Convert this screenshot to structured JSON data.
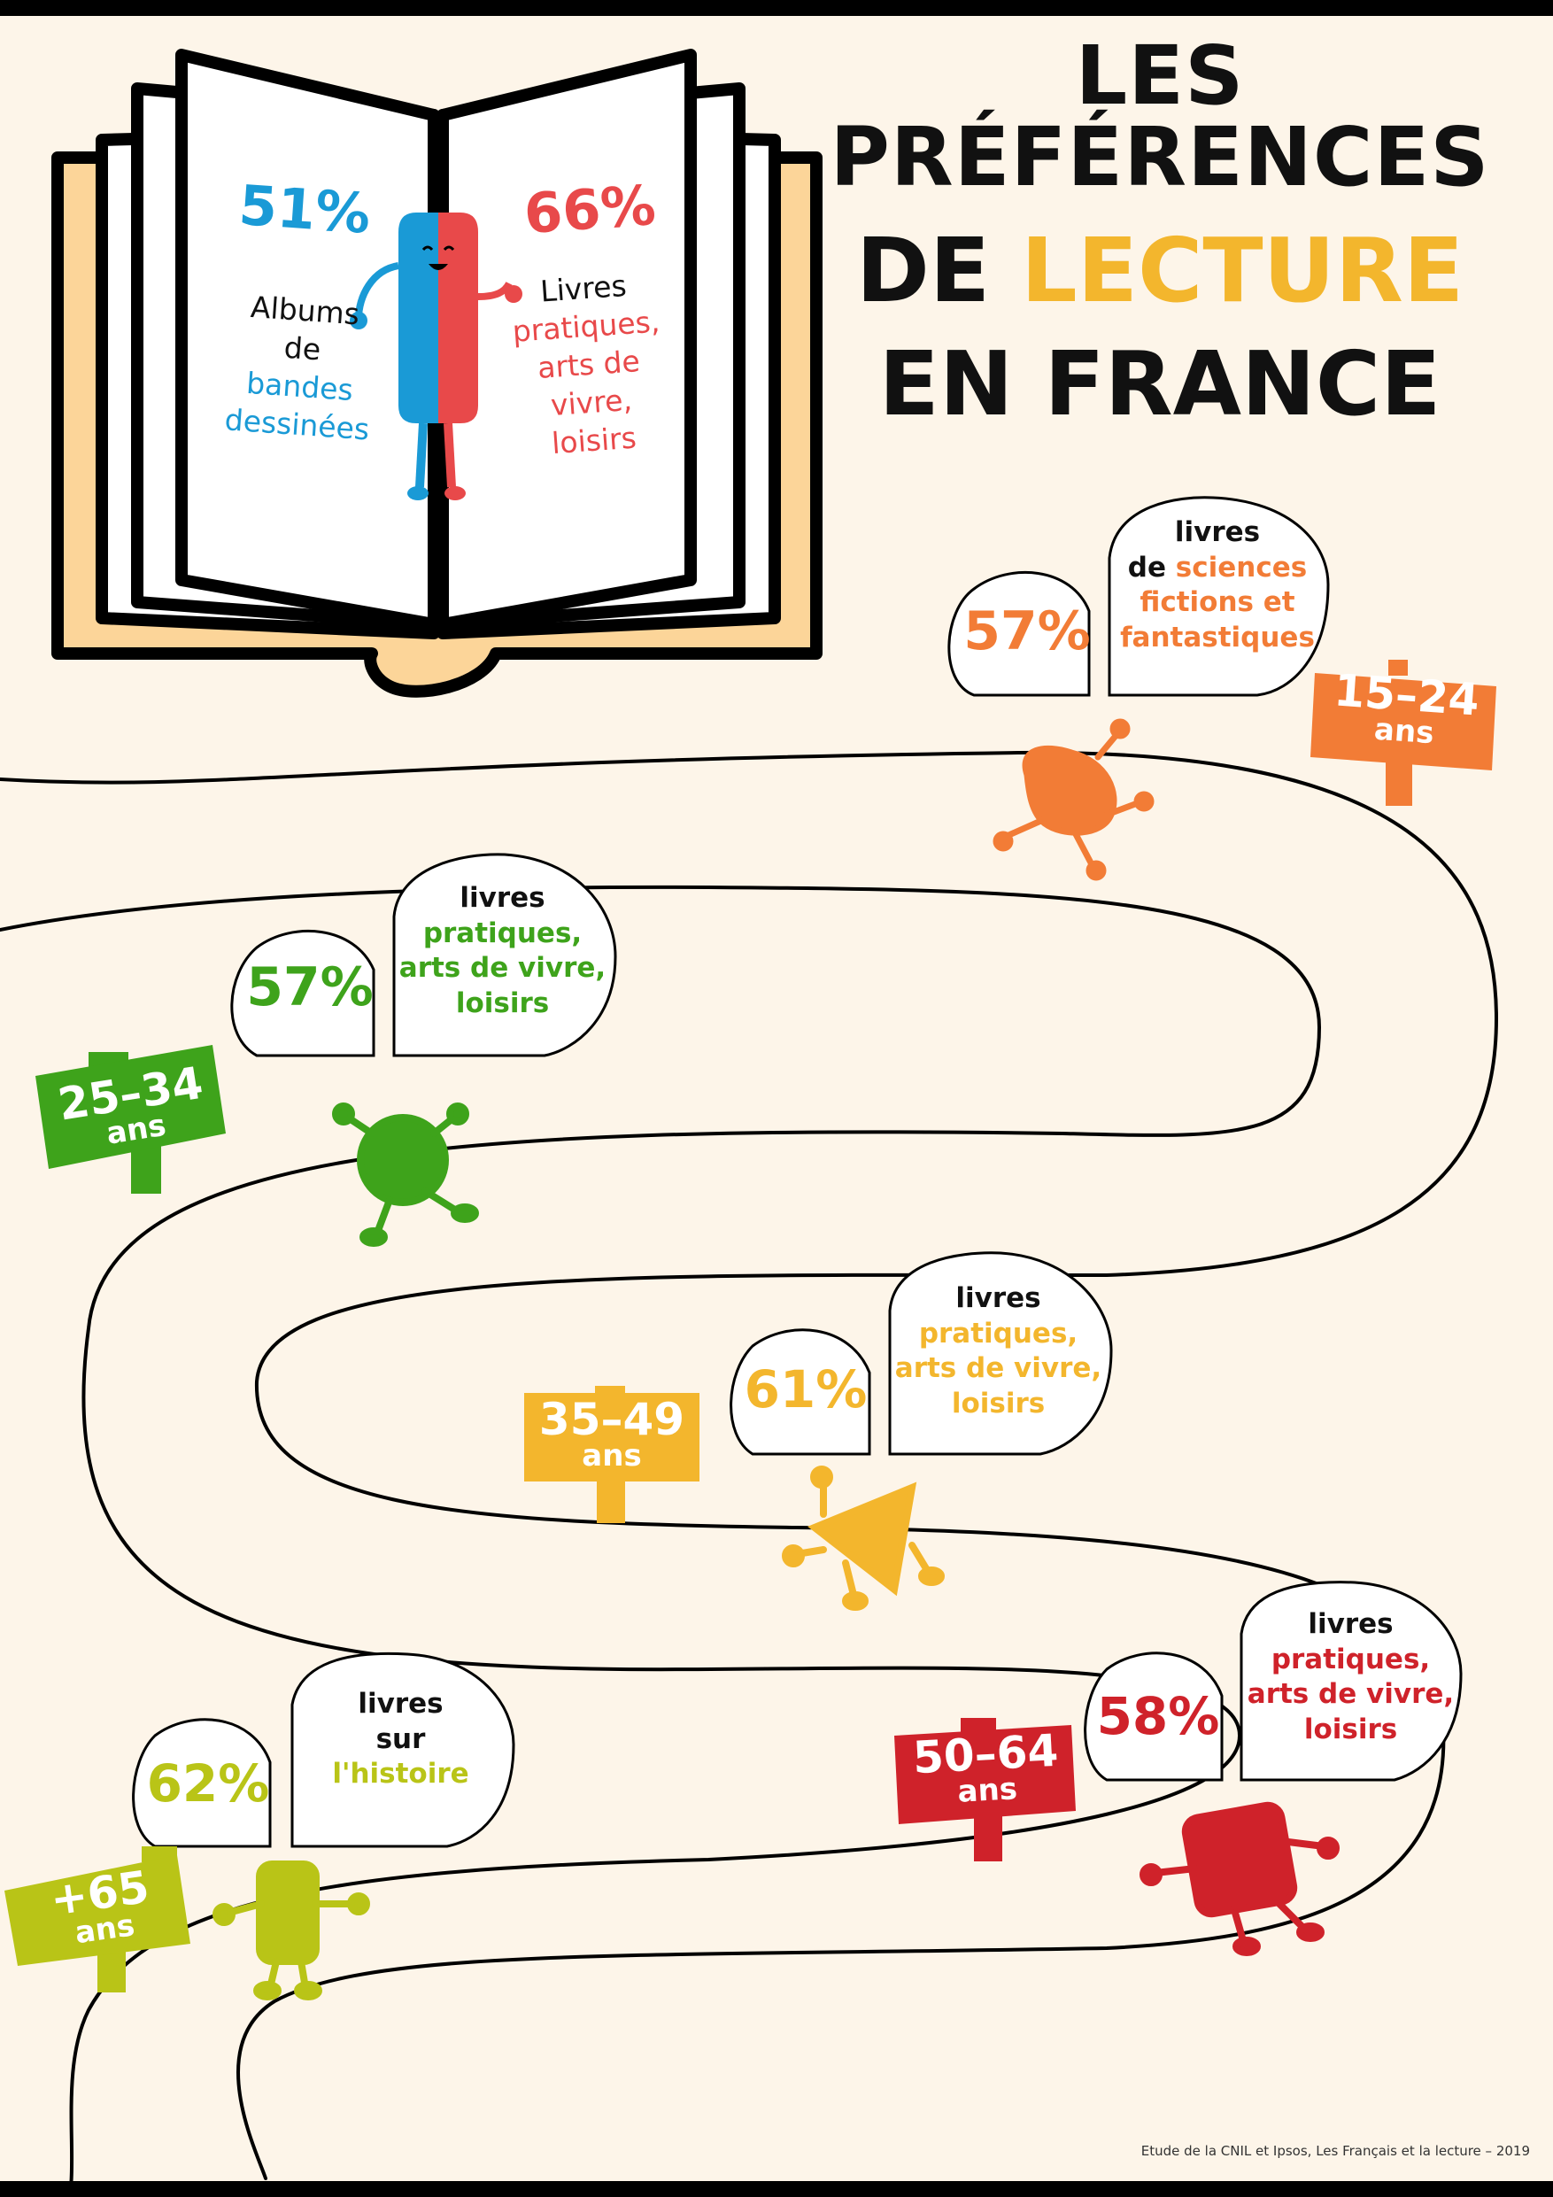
{
  "title": {
    "line1": "LES PRÉFÉRENCES",
    "line2_a": "DE ",
    "line2_b": "LECTURE",
    "line3": "EN FRANCE"
  },
  "book": {
    "left_percent": "51%",
    "left_label_1": "Albums",
    "left_label_2": "de",
    "left_label_3": "bandes",
    "left_label_4": "dessinées",
    "right_percent": "66%",
    "right_label_1": "Livres",
    "right_label_2": "pratiques,",
    "right_label_3": "arts de",
    "right_label_4": "vivre,",
    "right_label_5": "loisirs"
  },
  "groups": [
    {
      "age_1": "15–24",
      "age_2": "ans",
      "percent": "57%",
      "line_1": "livres",
      "line_2a": "de ",
      "line_2b": "sciences",
      "line_3": "fictions et",
      "line_4": "fantastiques",
      "color": "#f27c36"
    },
    {
      "age_1": "25–34",
      "age_2": "ans",
      "percent": "57%",
      "line_1": "livres",
      "line_2": "pratiques,",
      "line_3": "arts de vivre,",
      "line_4": "loisirs",
      "color": "#3ea31b"
    },
    {
      "age_1": "35–49",
      "age_2": "ans",
      "percent": "61%",
      "line_1": "livres",
      "line_2": "pratiques,",
      "line_3": "arts de vivre,",
      "line_4": "loisirs",
      "color": "#f3b62d"
    },
    {
      "age_1": "50–64",
      "age_2": "ans",
      "percent": "58%",
      "line_1": "livres",
      "line_2": "pratiques,",
      "line_3": "arts de vivre,",
      "line_4": "loisirs",
      "color": "#cf222a"
    },
    {
      "age_1": "+65",
      "age_2": "ans",
      "percent": "62%",
      "line_1": "livres",
      "line_2": "sur",
      "line_3": "l'histoire",
      "color": "#b9c417"
    }
  ],
  "colors": {
    "background": "#fdf5e9",
    "title_accent": "#f3b62d",
    "blue": "#1a9ad6",
    "red": "#e8494a",
    "book_cover": "#fcd599"
  },
  "source": "Etude de la CNIL et Ipsos, Les Français et la lecture – 2019"
}
